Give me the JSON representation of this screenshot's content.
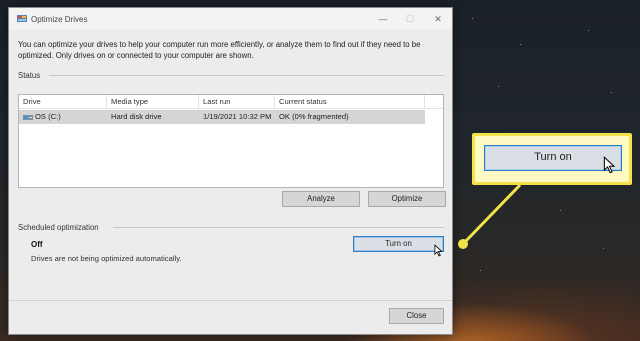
{
  "window": {
    "title": "Optimize Drives",
    "minimize_icon": "—",
    "maximize_icon": "☐",
    "close_icon": "✕"
  },
  "description": "You can optimize your drives to help your computer run more efficiently, or analyze them to find out if they need to be optimized. Only drives on or connected to your computer are shown.",
  "status": {
    "label": "Status",
    "columns": [
      "Drive",
      "Media type",
      "Last run",
      "Current status"
    ],
    "rows": [
      {
        "drive": "OS (C:)",
        "media_type": "Hard disk drive",
        "last_run": "1/19/2021 10:32 PM",
        "current_status": "OK (0% fragmented)"
      }
    ],
    "analyze_label": "Analyze",
    "optimize_label": "Optimize"
  },
  "scheduled": {
    "label": "Scheduled optimization",
    "state": "Off",
    "description": "Drives are not being optimized automatically.",
    "turn_on_label": "Turn on"
  },
  "close_label": "Close",
  "callout": {
    "button_label": "Turn on"
  },
  "colors": {
    "accent": "#2b7dc6",
    "callout_fill": "#fff9c4",
    "callout_border": "#f2e34a"
  }
}
